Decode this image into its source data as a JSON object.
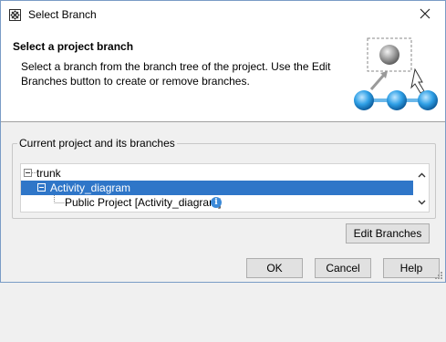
{
  "window": {
    "title": "Select Branch"
  },
  "header": {
    "title": "Select a project branch",
    "description": "Select a branch from the branch tree of the project. Use the Edit Branches button to create or remove branches."
  },
  "group": {
    "legend": "Current project and its branches",
    "tree": {
      "items": [
        {
          "label": "trunk",
          "expanded": true,
          "selected": false
        },
        {
          "label": "Activity_diagram",
          "expanded": true,
          "selected": true
        },
        {
          "label": "Public Project [Activity_diagram]",
          "selected": false
        }
      ]
    }
  },
  "buttons": {
    "edit_branches": "Edit Branches",
    "ok": "OK",
    "cancel": "Cancel",
    "help": "Help"
  },
  "colors": {
    "selection": "#2f76c8",
    "info": "#3c8ad8",
    "window_border": "#7a9cc6"
  }
}
